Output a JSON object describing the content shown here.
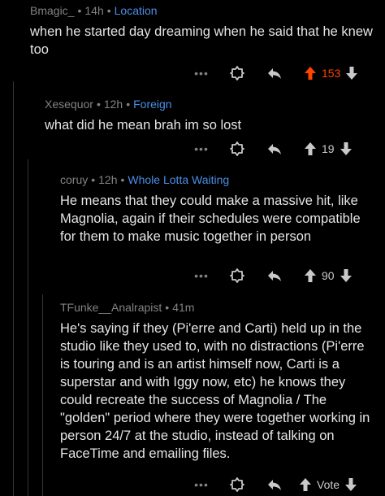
{
  "colors": {
    "background": "#000000",
    "text": "#e5e5e5",
    "meta": "#818384",
    "flair": "#4a8fe7",
    "upvoted": "#ff4500",
    "thread_line": "#343536"
  },
  "comments": [
    {
      "author": "Bmagic_",
      "time": "14h",
      "flair": "Location",
      "body": "when he started day dreaming when he said that he knew too",
      "score": "153",
      "upvoted": true
    },
    {
      "author": "Xesequor",
      "time": "12h",
      "flair": "Foreign",
      "body": "what did he mean brah im so lost",
      "score": "19",
      "upvoted": false
    },
    {
      "author": "coruy",
      "time": "12h",
      "flair": "Whole Lotta Waiting",
      "body": "He means that they could make a massive hit, like Magnolia, again if their schedules were compatible for them to make music together in person",
      "score": "90",
      "upvoted": false
    },
    {
      "author": "TFunke__Analrapist",
      "time": "41m",
      "flair": "",
      "body": "He's saying if they (Pi'erre and Carti) held up in the studio like they used to, with no distractions (Pi'erre is touring and is an artist himself now, Carti is a superstar and with Iggy now, etc) he knows they could recreate the success of Magnolia / The \"golden\" period where they were together working in person 24/7 at the studio, instead of talking on FaceTime and emailing files.",
      "score": "Vote",
      "upvoted": false
    }
  ],
  "icons": {
    "more": "more-options-icon",
    "award": "award-icon",
    "reply": "reply-icon",
    "upvote": "upvote-arrow-icon",
    "downvote": "downvote-arrow-icon"
  },
  "separator": "•",
  "more_glyph": "•••"
}
